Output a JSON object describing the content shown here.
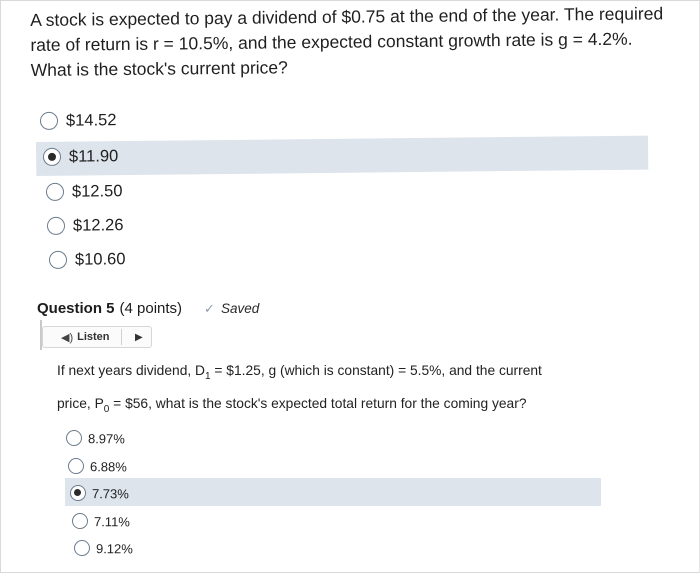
{
  "q4": {
    "text": "A stock is expected to pay a dividend of $0.75 at the end of the year. The required rate of return is r = 10.5%, and the expected constant growth rate is g = 4.2%. What is the stock's current price?",
    "options": [
      "$14.52",
      "$11.90",
      "$12.50",
      "$12.26",
      "$10.60"
    ],
    "selected_index": 1
  },
  "q5": {
    "title": "Question 5",
    "points": "(4 points)",
    "saved": "Saved",
    "listen": "Listen",
    "text_line1_pre": "If next years dividend, D",
    "text_sub1": "1",
    "text_line1_post": " = $1.25, g (which is constant) = 5.5%, and the current",
    "text_line2_pre": "price, P",
    "text_sub2": "0",
    "text_line2_post": " = $56, what is the stock's expected total return for the coming year?",
    "options": [
      "8.97%",
      "6.88%",
      "7.73%",
      "7.11%",
      "9.12%"
    ],
    "selected_index": 2
  }
}
